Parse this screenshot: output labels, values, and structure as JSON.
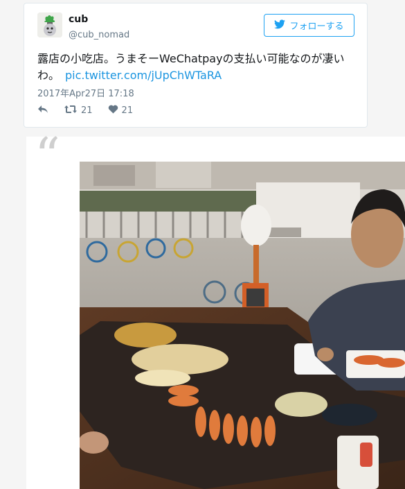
{
  "tweet": {
    "display_name": "cub",
    "handle": "@cub_nomad",
    "follow_label": "フォローする",
    "text": "露店の小吃店。うまそーWeChatpayの支払い可能なのが凄いわ。",
    "link": "pic.twitter.com/jUpChWTaRA",
    "timestamp": "2017年Apr27日 17:18",
    "retweet_count": "21",
    "like_count": "21"
  },
  "quote_mark": "“",
  "icons": {
    "follow": "twitter-bird-icon",
    "reply": "reply-icon",
    "retweet": "retweet-icon",
    "like": "heart-icon"
  },
  "colors": {
    "accent": "#1da1f2",
    "link": "#1b95e0",
    "muted": "#657786"
  }
}
